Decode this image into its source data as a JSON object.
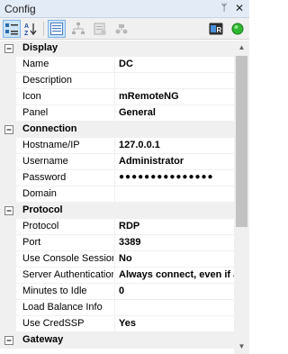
{
  "window": {
    "title": "Config",
    "pin_glyph": "ᛘ",
    "close_glyph": "✕"
  },
  "toolbar": {
    "buttons": [
      {
        "icon": "categorized-icon",
        "active": true
      },
      {
        "icon": "alphabetical-icon",
        "active": false
      },
      {
        "icon": "properties-icon",
        "active": true
      },
      {
        "icon": "default-inheritance-icon",
        "active": false
      },
      {
        "icon": "inheritance-icon",
        "active": false
      },
      {
        "icon": "host-status-icon",
        "active": false
      },
      {
        "icon": "rdp-icon",
        "active": false
      },
      {
        "icon": "status-green-icon",
        "active": false
      }
    ]
  },
  "grid": {
    "categories": {
      "display": "Display",
      "connection": "Connection",
      "protocol": "Protocol",
      "gateway": "Gateway"
    },
    "display": [
      {
        "name": "Name",
        "value": "DC"
      },
      {
        "name": "Description",
        "value": ""
      },
      {
        "name": "Icon",
        "value": "mRemoteNG"
      },
      {
        "name": "Panel",
        "value": "General"
      }
    ],
    "connection": [
      {
        "name": "Hostname/IP",
        "value": "127.0.0.1"
      },
      {
        "name": "Username",
        "value": "Administrator"
      },
      {
        "name": "Password",
        "value": "●●●●●●●●●●●●●●●"
      },
      {
        "name": "Domain",
        "value": ""
      }
    ],
    "protocol": [
      {
        "name": "Protocol",
        "value": "RDP"
      },
      {
        "name": "Port",
        "value": "3389"
      },
      {
        "name": "Use Console Session",
        "value": "No"
      },
      {
        "name": "Server Authentication",
        "value": "Always connect, even if auth"
      },
      {
        "name": "Minutes to Idle",
        "value": "0"
      },
      {
        "name": "Load Balance Info",
        "value": ""
      },
      {
        "name": "Use CredSSP",
        "value": "Yes"
      }
    ]
  },
  "scrollbar": {
    "up": "▲",
    "down": "▼"
  }
}
